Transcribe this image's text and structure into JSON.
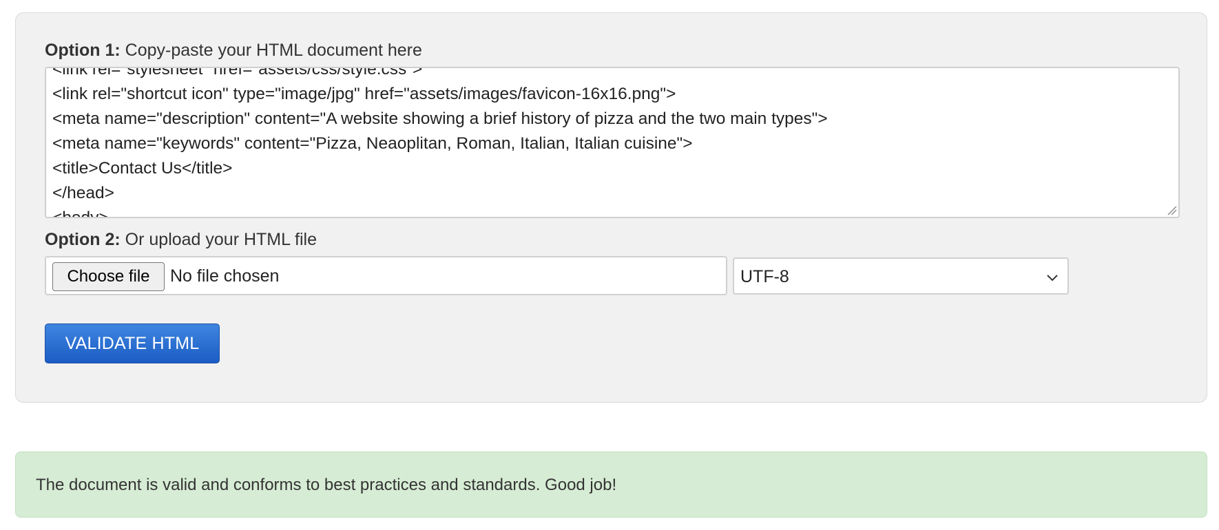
{
  "option1": {
    "label_bold": "Option 1:",
    "label_text": " Copy-paste your HTML document here",
    "textarea_lines": [
      "<link rel=\"stylesheet\" href=\"assets/css/style.css\">",
      "<link rel=\"shortcut icon\" type=\"image/jpg\" href=\"assets/images/favicon-16x16.png\">",
      "<meta name=\"description\" content=\"A website showing a brief history of pizza and the two main types\">",
      "<meta name=\"keywords\" content=\"Pizza, Neaoplitan, Roman, Italian, Italian cuisine\">",
      "<title>Contact Us</title>",
      "</head>",
      "<body>"
    ]
  },
  "option2": {
    "label_bold": "Option 2:",
    "label_text": " Or upload your HTML file",
    "choose_file_label": "Choose file",
    "no_file_text": "No file chosen",
    "encoding_value": "UTF-8"
  },
  "validate_button": "VALIDATE HTML",
  "result_message": "The document is valid and conforms to best practices and standards. Good job!",
  "colors": {
    "panel_bg": "#f1f1f1",
    "button_blue": "#2a6fd6",
    "success_bg": "#d6ecd4"
  }
}
